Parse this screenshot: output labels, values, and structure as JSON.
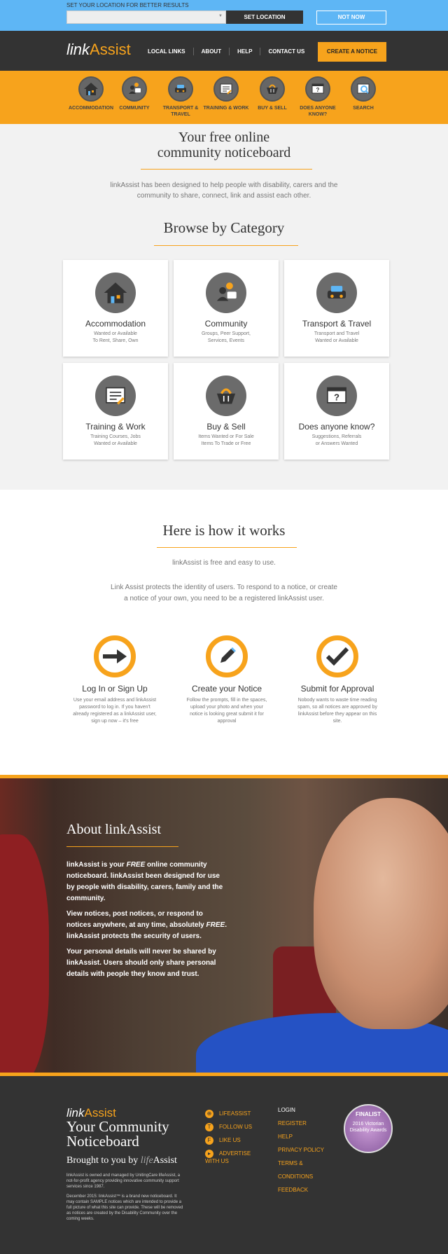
{
  "locationbar": {
    "label": "SET YOUR LOCATION FOR BETTER RESULTS",
    "select_value": "",
    "set_location": "SET LOCATION",
    "not_now": "NOT NOW"
  },
  "header": {
    "logo_link": "link",
    "logo_assist": "Assist",
    "nav": [
      "LOCAL LINKS",
      "ABOUT",
      "HELP",
      "CONTACT US"
    ],
    "create_button": "CREATE A NOTICE"
  },
  "categories_bar": [
    {
      "label": "ACCOMMODATION",
      "icon": "house-icon"
    },
    {
      "label": "COMMUNITY",
      "icon": "community-icon"
    },
    {
      "label": "TRANSPORT & TRAVEL",
      "icon": "car-icon"
    },
    {
      "label": "TRAINING & WORK",
      "icon": "training-icon"
    },
    {
      "label": "BUY & SELL",
      "icon": "basket-icon"
    },
    {
      "label": "DOES ANYONE KNOW?",
      "icon": "question-icon"
    },
    {
      "label": "SEARCH",
      "icon": "search-icon"
    }
  ],
  "hero": {
    "title_line1": "Your free online",
    "title_line2": "community noticeboard",
    "intro": "linkAssist has been designed to help people with disability, carers and the community to share, connect, link and assist each other."
  },
  "browse": {
    "title": "Browse by Category",
    "cards": [
      {
        "title": "Accommodation",
        "sub1": "Wanted or Available",
        "sub2": "To Rent, Share, Own",
        "icon": "house-icon"
      },
      {
        "title": "Community",
        "sub1": "Groups, Peer Support,",
        "sub2": "Services, Events",
        "icon": "community-icon"
      },
      {
        "title": "Transport & Travel",
        "sub1": "Transport and Travel",
        "sub2": "Wanted or Available",
        "icon": "car-icon"
      },
      {
        "title": "Training & Work",
        "sub1": "Training Courses, Jobs",
        "sub2": "Wanted or Available",
        "icon": "training-icon"
      },
      {
        "title": "Buy & Sell",
        "sub1": "Items Wanted or For Sale",
        "sub2": "Items To Trade or Free",
        "icon": "basket-icon"
      },
      {
        "title": "Does anyone know?",
        "sub1": "Suggestions, Referrals",
        "sub2": "or Answers Wanted",
        "icon": "question-icon"
      }
    ]
  },
  "how": {
    "title": "Here is how it works",
    "p1": "linkAssist is free and easy to use.",
    "p2": "Link Assist protects the identity of users. To respond to a notice, or create a notice of your own, you need to be a registered linkAssist user.",
    "steps": [
      {
        "title": "Log In or Sign Up",
        "text": "Use your email address and linkAssist password to log in. If you haven't already registered as a linkAssist user, sign up now – it's free",
        "icon": "arrow-icon"
      },
      {
        "title": "Create your Notice",
        "text": "Follow the prompts, fill in the spaces, upload your photo and when your notice is looking great submit it for approval",
        "icon": "pencil-icon"
      },
      {
        "title": "Submit for Approval",
        "text": "Nobody wants to waste time reading spam, so all notices are approved by linkAssist before they appear on this site.",
        "icon": "check-icon"
      }
    ]
  },
  "about": {
    "title": "About linkAssist",
    "p1a": "linkAssist is your ",
    "p1b": "FREE",
    "p1c": " online community noticeboard. linkAssist been designed for use by people with disability, carers, family and the community.",
    "p2a": "View notices, post notices, or respond to notices anywhere, at any time, absolutely ",
    "p2b": "FREE",
    "p2c": ". linkAssist protects the security of users.",
    "p3": "Your personal details will never be shared by linkAssist. Users should only share personal details with people they know and trust."
  },
  "footer": {
    "logo_link": "link",
    "logo_assist": "Assist",
    "tag1": "Your Community",
    "tag2": "Noticeboard",
    "brought": "Brought to you by ",
    "brought_life": "life",
    "brought_assist": "Assist",
    "small1": "linkAssist is owned and managed by UnitingCare lifeAssist, a not-for-profit agency providing innovative community support services since 1987.",
    "small2": "December 2015: linkAssist™ is a brand new noticeboard. It may contain SAMPLE notices which are intended to provide a full picture of what this site can provide. These will be removed as notices are created by the Disability Community over the coming weeks.",
    "social": [
      {
        "label": "LIFEASSIST",
        "icon": "globe-icon"
      },
      {
        "label": "FOLLOW US",
        "icon": "twitter-icon"
      },
      {
        "label": "LIKE US",
        "icon": "facebook-icon"
      },
      {
        "label": "ADVERTISE",
        "icon": "advertise-icon"
      }
    ],
    "social_cont": "WITH US",
    "links": [
      "LOGIN",
      "REGISTER",
      "HELP",
      "PRIVACY POLICY",
      "TERMS &",
      "CONDITIONS",
      "FEEDBACK"
    ],
    "badge1": "FINALIST",
    "badge2": "2016 Victorian Disability Awards"
  },
  "colors": {
    "accent": "#f7a31c",
    "dark": "#333333",
    "sky": "#5eb6f5"
  }
}
